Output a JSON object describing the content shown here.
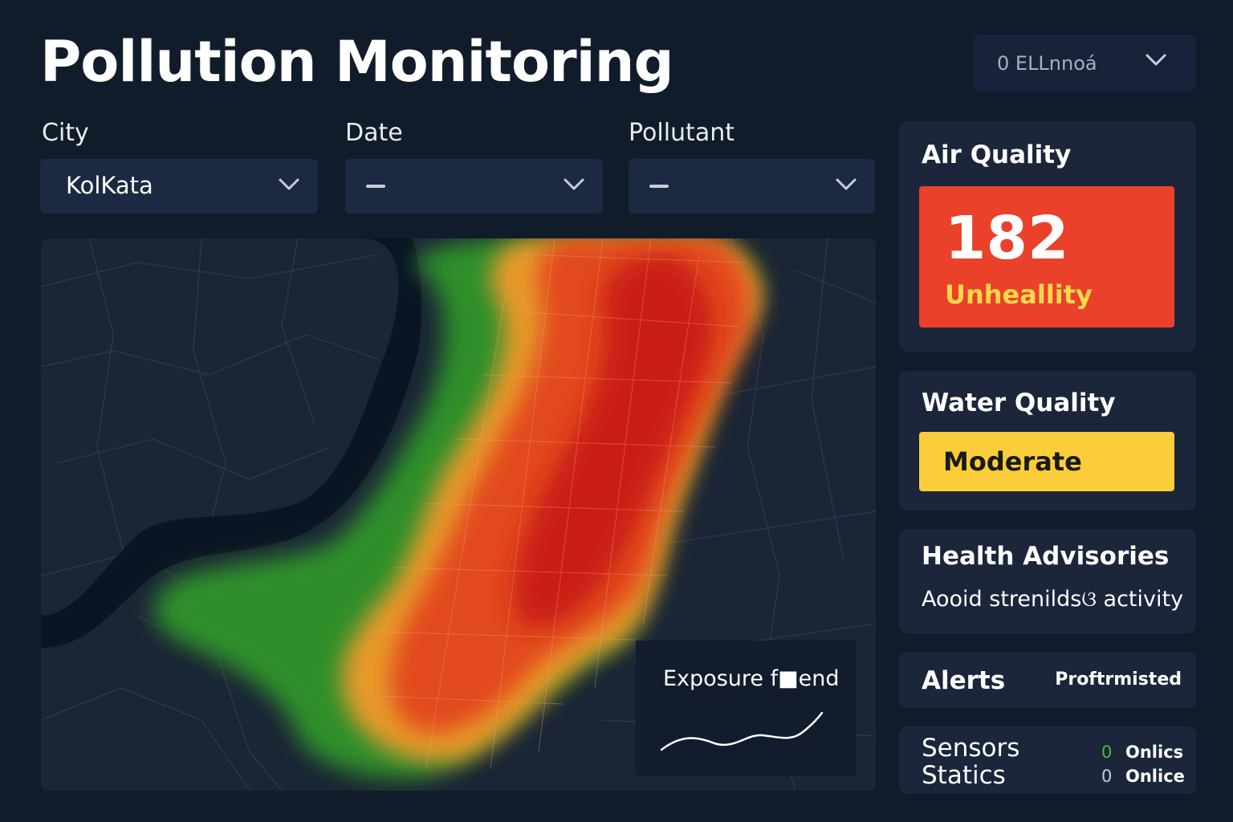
{
  "header": {
    "title": "Pollution Monitoring",
    "account_select": "0  ELLnnoá"
  },
  "filters": {
    "city": {
      "label": "City",
      "value": "KolKata"
    },
    "date": {
      "label": "Date",
      "value": "–"
    },
    "pollutant": {
      "label": "Pollutant",
      "value": "–"
    }
  },
  "map": {
    "trend_label": "Exposure f■end",
    "heat_colors": [
      "#2e8b2e",
      "#f0a030",
      "#d82c1c"
    ]
  },
  "air_quality": {
    "title": "Air Quality",
    "value": "182",
    "status": "Unheallity",
    "color": "#ea412b"
  },
  "water_quality": {
    "title": "Water Quality",
    "status": "Moderate",
    "color": "#fbcd3a"
  },
  "health_advisories": {
    "title": "Health Advisories",
    "text": "Aooid strenildsଓ activity"
  },
  "alerts": {
    "title": "Alerts",
    "status": "Proftrmisted"
  },
  "sensors": {
    "title_line1": "Sensors",
    "title_line2": "Statics",
    "rows": [
      {
        "count": "0",
        "label": "Onlics",
        "color": "#3fbf3f"
      },
      {
        "count": "0",
        "label": "Onlice",
        "color": "#c8ced6"
      }
    ]
  },
  "icons": [
    "chevron-down-icon",
    "dash-icon",
    "trend-line-icon"
  ]
}
